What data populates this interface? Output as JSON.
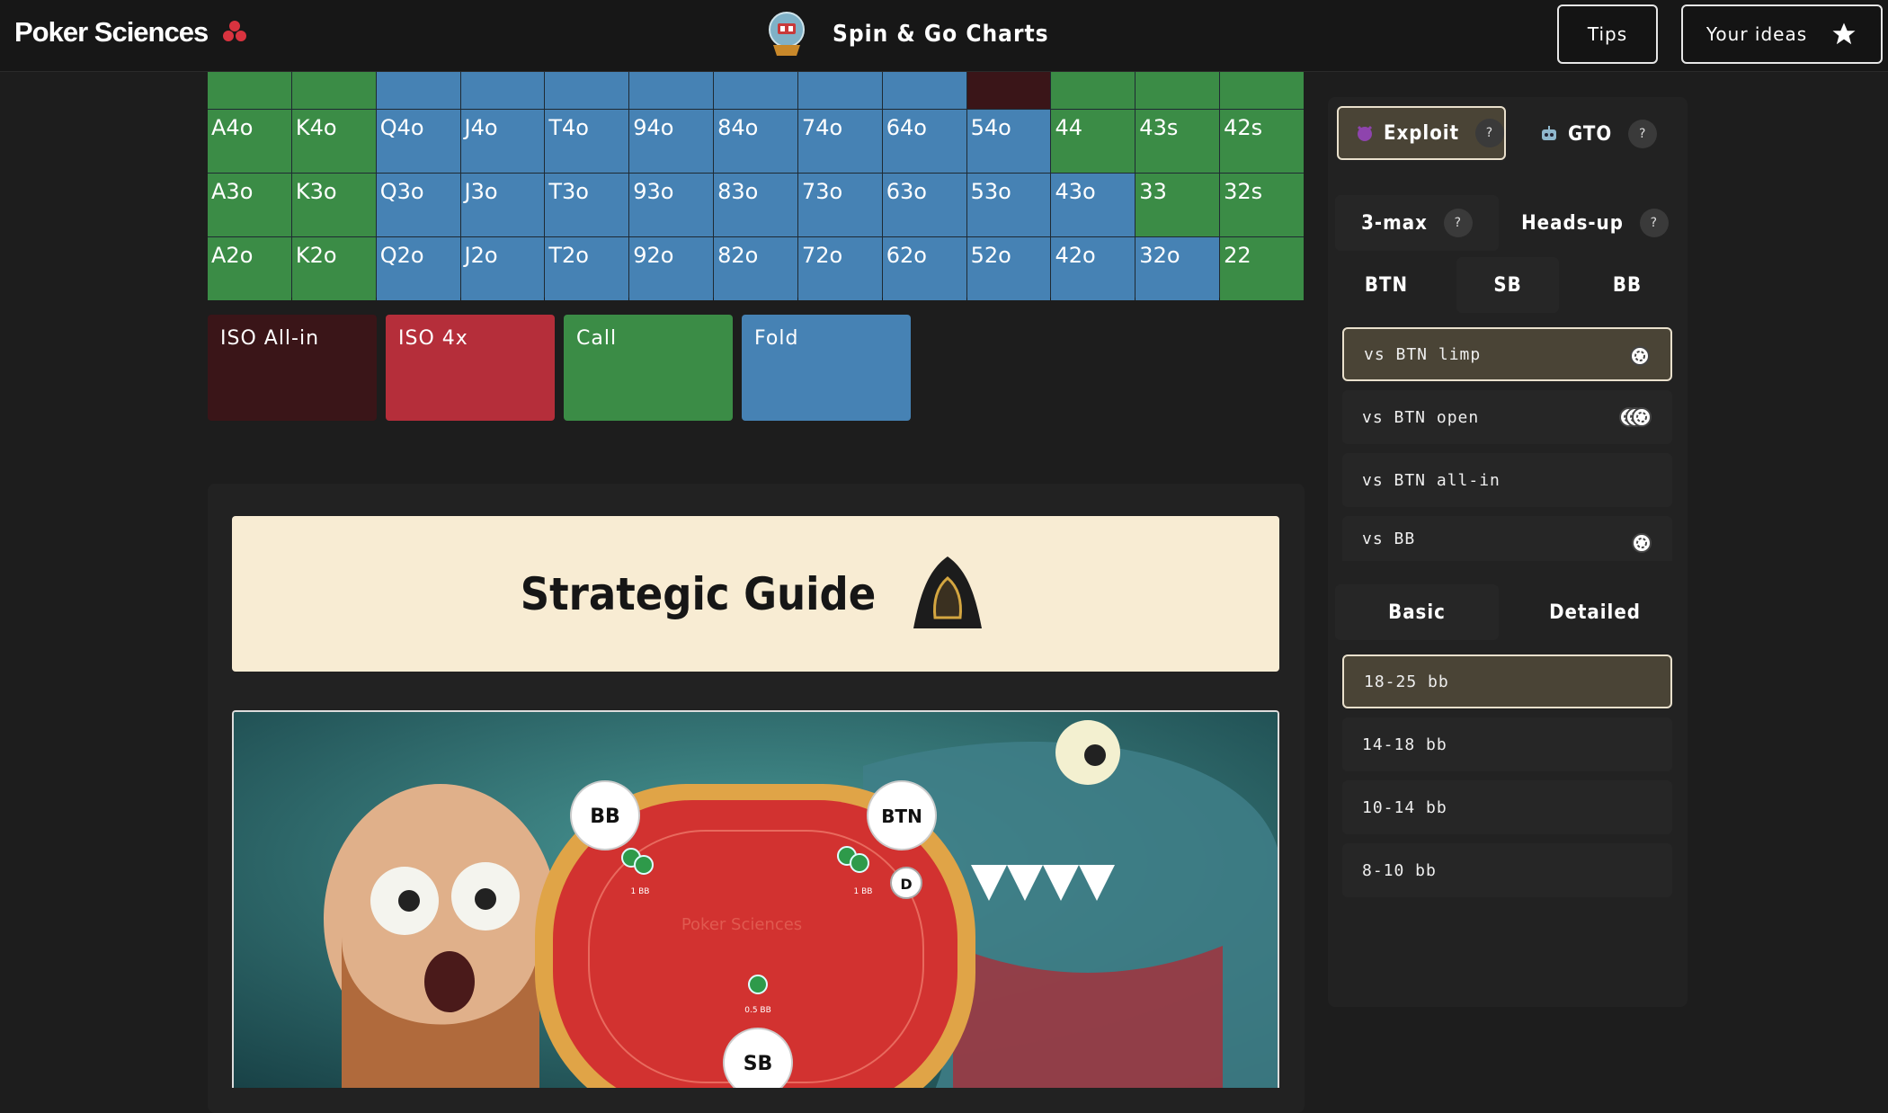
{
  "header": {
    "brand": "Poker Sciences",
    "title": "Spin & Go Charts",
    "tips_label": "Tips",
    "ideas_label": "Your ideas"
  },
  "grid": {
    "rows": [
      [
        {
          "t": "",
          "c": "g"
        },
        {
          "t": "",
          "c": "g"
        },
        {
          "t": "",
          "c": "b"
        },
        {
          "t": "",
          "c": "b"
        },
        {
          "t": "",
          "c": "b"
        },
        {
          "t": "",
          "c": "b"
        },
        {
          "t": "",
          "c": "b"
        },
        {
          "t": "",
          "c": "b"
        },
        {
          "t": "",
          "c": "b"
        },
        {
          "t": "",
          "c": "d"
        },
        {
          "t": "",
          "c": "g"
        },
        {
          "t": "",
          "c": "g"
        },
        {
          "t": "",
          "c": "g"
        }
      ],
      [
        {
          "t": "A4o",
          "c": "g"
        },
        {
          "t": "K4o",
          "c": "g"
        },
        {
          "t": "Q4o",
          "c": "b"
        },
        {
          "t": "J4o",
          "c": "b"
        },
        {
          "t": "T4o",
          "c": "b"
        },
        {
          "t": "94o",
          "c": "b"
        },
        {
          "t": "84o",
          "c": "b"
        },
        {
          "t": "74o",
          "c": "b"
        },
        {
          "t": "64o",
          "c": "b"
        },
        {
          "t": "54o",
          "c": "b"
        },
        {
          "t": "44",
          "c": "g"
        },
        {
          "t": "43s",
          "c": "g"
        },
        {
          "t": "42s",
          "c": "g"
        }
      ],
      [
        {
          "t": "A3o",
          "c": "g"
        },
        {
          "t": "K3o",
          "c": "g"
        },
        {
          "t": "Q3o",
          "c": "b"
        },
        {
          "t": "J3o",
          "c": "b"
        },
        {
          "t": "T3o",
          "c": "b"
        },
        {
          "t": "93o",
          "c": "b"
        },
        {
          "t": "83o",
          "c": "b"
        },
        {
          "t": "73o",
          "c": "b"
        },
        {
          "t": "63o",
          "c": "b"
        },
        {
          "t": "53o",
          "c": "b"
        },
        {
          "t": "43o",
          "c": "b"
        },
        {
          "t": "33",
          "c": "g"
        },
        {
          "t": "32s",
          "c": "g"
        }
      ],
      [
        {
          "t": "A2o",
          "c": "g"
        },
        {
          "t": "K2o",
          "c": "g"
        },
        {
          "t": "Q2o",
          "c": "b"
        },
        {
          "t": "J2o",
          "c": "b"
        },
        {
          "t": "T2o",
          "c": "b"
        },
        {
          "t": "92o",
          "c": "b"
        },
        {
          "t": "82o",
          "c": "b"
        },
        {
          "t": "72o",
          "c": "b"
        },
        {
          "t": "62o",
          "c": "b"
        },
        {
          "t": "52o",
          "c": "b"
        },
        {
          "t": "42o",
          "c": "b"
        },
        {
          "t": "32o",
          "c": "b"
        },
        {
          "t": "22",
          "c": "g"
        }
      ]
    ]
  },
  "legend": [
    {
      "label": "ISO All-in",
      "color": "#3a1518"
    },
    {
      "label": "ISO 4x",
      "color": "#b52e3a"
    },
    {
      "label": "Call",
      "color": "#3b8c46"
    },
    {
      "label": "Fold",
      "color": "#4682b4"
    }
  ],
  "guide": {
    "title": "Strategic Guide",
    "table": {
      "bb_label": "BB",
      "btn_label": "BTN",
      "sb_label": "SB",
      "dealer_label": "D",
      "bb_bet": "1 BB",
      "btn_bet": "1 BB",
      "sb_bet": "0.5 BB",
      "felt_text": "Poker Sciences"
    }
  },
  "side": {
    "mode_tabs": [
      {
        "label": "Exploit"
      },
      {
        "label": "GTO"
      }
    ],
    "format_tabs": [
      {
        "label": "3-max"
      },
      {
        "label": "Heads-up"
      }
    ],
    "positions": [
      "BTN",
      "SB",
      "BB"
    ],
    "situations": [
      {
        "label": "vs BTN limp",
        "chips": 1,
        "active": true
      },
      {
        "label": "vs BTN open",
        "chips": 3,
        "active": false
      },
      {
        "label": "vs BTN all-in",
        "chips": 0,
        "active": false
      },
      {
        "label": "vs BB",
        "chips": 1,
        "active": false
      }
    ],
    "detail_tabs": [
      {
        "label": "Basic"
      },
      {
        "label": "Detailed"
      }
    ],
    "stacks": [
      {
        "label": "18-25 bb",
        "active": true
      },
      {
        "label": "14-18 bb",
        "active": false
      },
      {
        "label": "10-14 bb",
        "active": false
      },
      {
        "label": "8-10 bb",
        "active": false
      }
    ],
    "help": "?"
  },
  "colors": {
    "green": "#3b8c46",
    "blue": "#4682b4",
    "dark_red": "#3a1518",
    "red": "#b52e3a",
    "cream": "#f8ecd3"
  }
}
